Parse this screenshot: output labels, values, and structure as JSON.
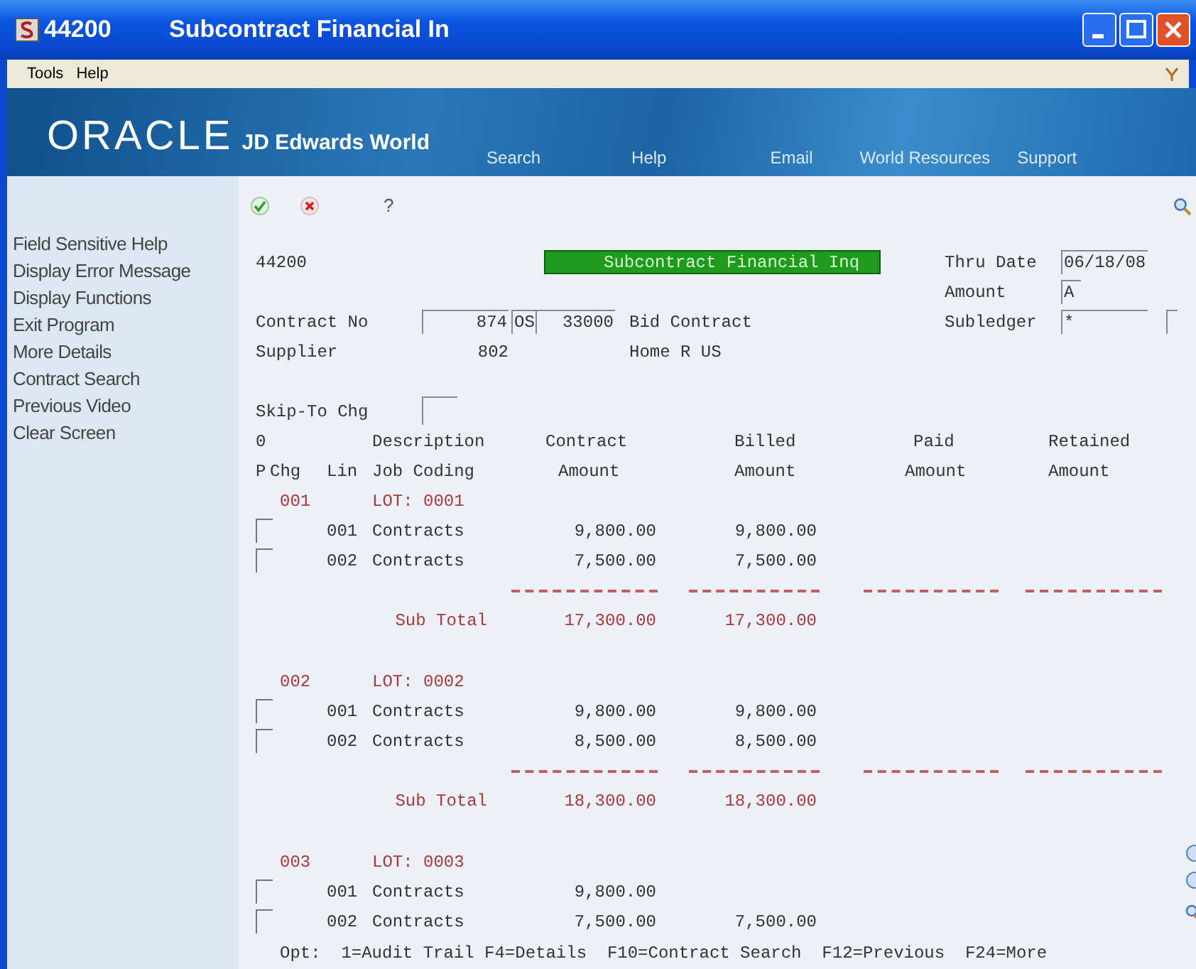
{
  "window": {
    "program": "44200",
    "title": "Subcontract Financial In"
  },
  "menu": [
    "Tools",
    "Help"
  ],
  "banner": {
    "brand": "ORACLE",
    "product": "JD Edwards World",
    "links": [
      "Search",
      "Help",
      "Email",
      "World Resources",
      "Support"
    ]
  },
  "sidebar": {
    "items": [
      "Field Sensitive Help",
      "Display Error Message",
      "Display Functions",
      "Exit Program",
      "More Details",
      "Contract Search",
      "Previous Video",
      "Clear Screen"
    ]
  },
  "toolbar": {
    "help": "?"
  },
  "form": {
    "program": "44200",
    "heading": "Subcontract Financial Inq",
    "thru_date": {
      "label": "Thru Date",
      "value": "06/18/08"
    },
    "amount": {
      "label": "Amount",
      "value": "A"
    },
    "contract": {
      "label": "Contract No",
      "number": "874",
      "type": "OS",
      "company": "33000",
      "description": "Bid Contract"
    },
    "subledger": {
      "label": "Subledger",
      "value": "*"
    },
    "supplier": {
      "label": "Supplier",
      "number": "802",
      "name": "Home R US"
    },
    "skip_to": {
      "label": "Skip-To Chg"
    }
  },
  "grid": {
    "header_1": [
      "0",
      "Description",
      "Contract",
      "Billed",
      "Paid",
      "Retained"
    ],
    "header_2": [
      "P",
      "Chg",
      "Lin",
      "Job Coding",
      "Amount",
      "Amount",
      "Amount",
      "Amount"
    ],
    "lots": [
      {
        "chg": "001",
        "lot": "LOT: 0001",
        "lines": [
          {
            "lin": "001",
            "description": "Contracts",
            "contract": "9,800.00",
            "billed": "9,800.00"
          },
          {
            "lin": "002",
            "description": "Contracts",
            "contract": "7,500.00",
            "billed": "7,500.00"
          }
        ],
        "subtotal": {
          "label": "Sub Total",
          "contract": "17,300.00",
          "billed": "17,300.00"
        }
      },
      {
        "chg": "002",
        "lot": "LOT: 0002",
        "lines": [
          {
            "lin": "001",
            "description": "Contracts",
            "contract": "9,800.00",
            "billed": "9,800.00"
          },
          {
            "lin": "002",
            "description": "Contracts",
            "contract": "8,500.00",
            "billed": "8,500.00"
          }
        ],
        "subtotal": {
          "label": "Sub Total",
          "contract": "18,300.00",
          "billed": "18,300.00"
        }
      },
      {
        "chg": "003",
        "lot": "LOT: 0003",
        "lines": [
          {
            "lin": "001",
            "description": "Contracts",
            "contract": "9,800.00"
          },
          {
            "lin": "002",
            "description": "Contracts",
            "contract": "7,500.00",
            "billed": "7,500.00"
          }
        ]
      }
    ]
  },
  "footer": "Opt:  1=Audit Trail F4=Details  F10=Contract Search  F12=Previous  F24=More"
}
